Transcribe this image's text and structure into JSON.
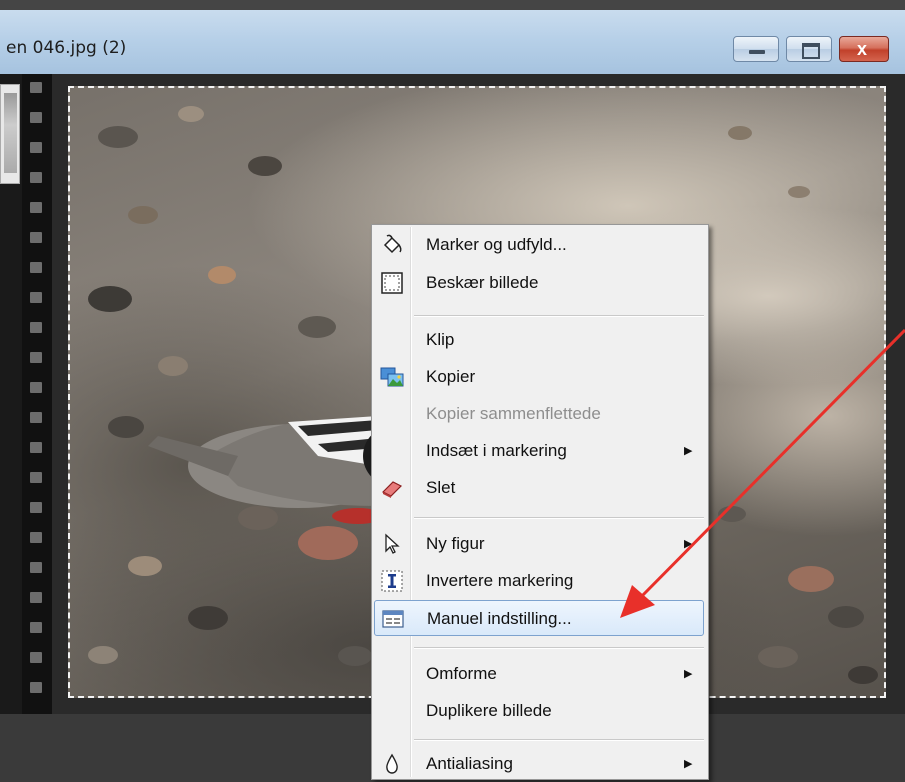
{
  "window": {
    "title": "en 046.jpg (2)",
    "minimize_label": "",
    "maximize_label": "",
    "close_label": "x"
  },
  "context_menu": {
    "items": [
      {
        "label": "Marker og udfyld...",
        "icon": "fill-bucket-icon",
        "enabled": true,
        "submenu": false
      },
      {
        "label": "Beskær billede",
        "icon": "crop-icon",
        "enabled": true,
        "submenu": false
      },
      {
        "label": "Klip",
        "icon": "",
        "enabled": true,
        "submenu": false
      },
      {
        "label": "Kopier",
        "icon": "copy-image-icon",
        "enabled": true,
        "submenu": false
      },
      {
        "label": "Kopier sammenflettede",
        "icon": "",
        "enabled": false,
        "submenu": false
      },
      {
        "label": "Indsæt i markering",
        "icon": "",
        "enabled": true,
        "submenu": true
      },
      {
        "label": "Slet",
        "icon": "eraser-icon",
        "enabled": true,
        "submenu": false
      },
      {
        "label": "Ny figur",
        "icon": "pointer-icon",
        "enabled": true,
        "submenu": true
      },
      {
        "label": "Invertere markering",
        "icon": "invert-selection-icon",
        "enabled": true,
        "submenu": false
      },
      {
        "label": "Manuel indstilling...",
        "icon": "manual-settings-icon",
        "enabled": true,
        "submenu": false,
        "highlighted": true
      },
      {
        "label": "Omforme",
        "icon": "",
        "enabled": true,
        "submenu": true
      },
      {
        "label": "Duplikere billede",
        "icon": "",
        "enabled": true,
        "submenu": false
      },
      {
        "label": "Antialiasing",
        "icon": "antialias-drop-icon",
        "enabled": true,
        "submenu": true
      }
    ]
  },
  "colors": {
    "annotation_arrow": "#e8302a",
    "menu_highlight_border": "#7da2ce",
    "disabled_text": "#8e8e8e"
  }
}
